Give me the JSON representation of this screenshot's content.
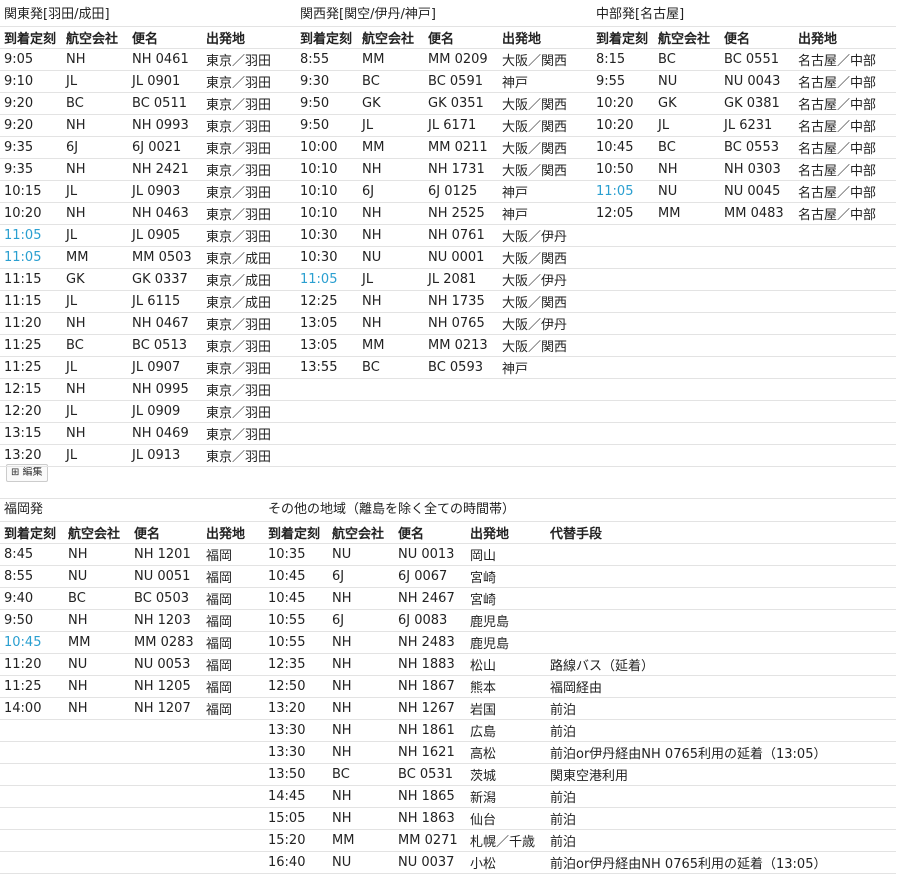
{
  "kanto": {
    "title": "関東発[羽田/成田]",
    "headers": [
      "到着定刻",
      "航空会社",
      "便名",
      "出発地"
    ],
    "rows": [
      [
        "9:05",
        "NH",
        "NH 0461",
        "東京／羽田"
      ],
      [
        "9:10",
        "JL",
        "JL 0901",
        "東京／羽田"
      ],
      [
        "9:20",
        "BC",
        "BC 0511",
        "東京／羽田"
      ],
      [
        "9:20",
        "NH",
        "NH 0993",
        "東京／羽田"
      ],
      [
        "9:35",
        "6J",
        "6J 0021",
        "東京／羽田"
      ],
      [
        "9:35",
        "NH",
        "NH 2421",
        "東京／羽田"
      ],
      [
        "10:15",
        "JL",
        "JL 0903",
        "東京／羽田"
      ],
      [
        "10:20",
        "NH",
        "NH 0463",
        "東京／羽田"
      ],
      [
        "11:05",
        "JL",
        "JL 0905",
        "東京／羽田"
      ],
      [
        "11:05",
        "MM",
        "MM 0503",
        "東京／成田"
      ],
      [
        "11:15",
        "GK",
        "GK 0337",
        "東京／成田"
      ],
      [
        "11:15",
        "JL",
        "JL 6115",
        "東京／成田"
      ],
      [
        "11:20",
        "NH",
        "NH 0467",
        "東京／羽田"
      ],
      [
        "11:25",
        "BC",
        "BC 0513",
        "東京／羽田"
      ],
      [
        "11:25",
        "JL",
        "JL 0907",
        "東京／羽田"
      ],
      [
        "12:15",
        "NH",
        "NH 0995",
        "東京／羽田"
      ],
      [
        "12:20",
        "JL",
        "JL 0909",
        "東京／羽田"
      ],
      [
        "13:15",
        "NH",
        "NH 0469",
        "東京／羽田"
      ],
      [
        "13:20",
        "JL",
        "JL 0913",
        "東京／羽田"
      ]
    ],
    "highlight_rows": [
      8,
      9
    ]
  },
  "kansai": {
    "title": "関西発[関空/伊丹/神戸]",
    "headers": [
      "到着定刻",
      "航空会社",
      "便名",
      "出発地"
    ],
    "rows": [
      [
        "8:55",
        "MM",
        "MM 0209",
        "大阪／関西"
      ],
      [
        "9:30",
        "BC",
        "BC 0591",
        "神戸"
      ],
      [
        "9:50",
        "GK",
        "GK 0351",
        "大阪／関西"
      ],
      [
        "9:50",
        "JL",
        "JL 6171",
        "大阪／関西"
      ],
      [
        "10:00",
        "MM",
        "MM 0211",
        "大阪／関西"
      ],
      [
        "10:10",
        "NH",
        "NH 1731",
        "大阪／関西"
      ],
      [
        "10:10",
        "6J",
        "6J 0125",
        "神戸"
      ],
      [
        "10:10",
        "NH",
        "NH 2525",
        "神戸"
      ],
      [
        "10:30",
        "NH",
        "NH 0761",
        "大阪／伊丹"
      ],
      [
        "10:30",
        "NU",
        "NU 0001",
        "大阪／関西"
      ],
      [
        "11:05",
        "JL",
        "JL 2081",
        "大阪／伊丹"
      ],
      [
        "12:25",
        "NH",
        "NH 1735",
        "大阪／関西"
      ],
      [
        "13:05",
        "NH",
        "NH 0765",
        "大阪／伊丹"
      ],
      [
        "13:05",
        "MM",
        "MM 0213",
        "大阪／関西"
      ],
      [
        "13:55",
        "BC",
        "BC 0593",
        "神戸"
      ]
    ],
    "highlight_rows": [
      10
    ]
  },
  "chubu": {
    "title": "中部発[名古屋]",
    "headers": [
      "到着定刻",
      "航空会社",
      "便名",
      "出発地"
    ],
    "rows": [
      [
        "8:15",
        "BC",
        "BC 0551",
        "名古屋／中部"
      ],
      [
        "9:55",
        "NU",
        "NU 0043",
        "名古屋／中部"
      ],
      [
        "10:20",
        "GK",
        "GK 0381",
        "名古屋／中部"
      ],
      [
        "10:20",
        "JL",
        "JL 6231",
        "名古屋／中部"
      ],
      [
        "10:45",
        "BC",
        "BC 0553",
        "名古屋／中部"
      ],
      [
        "10:50",
        "NH",
        "NH 0303",
        "名古屋／中部"
      ],
      [
        "11:05",
        "NU",
        "NU 0045",
        "名古屋／中部"
      ],
      [
        "12:05",
        "MM",
        "MM 0483",
        "名古屋／中部"
      ]
    ],
    "highlight_rows": [
      6
    ]
  },
  "edit_label": "⊞ 編集",
  "fukuoka": {
    "title": "福岡発",
    "headers": [
      "到着定刻",
      "航空会社",
      "便名",
      "出発地"
    ],
    "rows": [
      [
        "8:45",
        "NH",
        "NH 1201",
        "福岡"
      ],
      [
        "8:55",
        "NU",
        "NU 0051",
        "福岡"
      ],
      [
        "9:40",
        "BC",
        "BC 0503",
        "福岡"
      ],
      [
        "9:50",
        "NH",
        "NH 1203",
        "福岡"
      ],
      [
        "10:45",
        "MM",
        "MM 0283",
        "福岡"
      ],
      [
        "11:20",
        "NU",
        "NU 0053",
        "福岡"
      ],
      [
        "11:25",
        "NH",
        "NH 1205",
        "福岡"
      ],
      [
        "14:00",
        "NH",
        "NH 1207",
        "福岡"
      ]
    ],
    "highlight_rows": [
      4
    ]
  },
  "other": {
    "title": "その他の地域（離島を除く全ての時間帯）",
    "headers": [
      "到着定刻",
      "航空会社",
      "便名",
      "出発地",
      "代替手段"
    ],
    "rows": [
      [
        "10:35",
        "NU",
        "NU 0013",
        "岡山",
        ""
      ],
      [
        "10:45",
        "6J",
        "6J 0067",
        "宮崎",
        ""
      ],
      [
        "10:45",
        "NH",
        "NH 2467",
        "宮崎",
        ""
      ],
      [
        "10:55",
        "6J",
        "6J 0083",
        "鹿児島",
        ""
      ],
      [
        "10:55",
        "NH",
        "NH 2483",
        "鹿児島",
        ""
      ],
      [
        "12:35",
        "NH",
        "NH 1883",
        "松山",
        "路線バス（延着）"
      ],
      [
        "12:50",
        "NH",
        "NH 1867",
        "熊本",
        "福岡経由"
      ],
      [
        "13:20",
        "NH",
        "NH 1267",
        "岩国",
        "前泊"
      ],
      [
        "13:30",
        "NH",
        "NH 1861",
        "広島",
        "前泊"
      ],
      [
        "13:30",
        "NH",
        "NH 1621",
        "高松",
        "前泊or伊丹経由NH 0765利用の延着（13:05）"
      ],
      [
        "13:50",
        "BC",
        "BC 0531",
        "茨城",
        "関東空港利用"
      ],
      [
        "14:45",
        "NH",
        "NH 1865",
        "新潟",
        "前泊"
      ],
      [
        "15:05",
        "NH",
        "NH 1863",
        "仙台",
        "前泊"
      ],
      [
        "15:20",
        "MM",
        "MM 0271",
        "札幌／千歳",
        "前泊"
      ],
      [
        "16:40",
        "NU",
        "NU 0037",
        "小松",
        "前泊or伊丹経由NH 0765利用の延着（13:05）"
      ]
    ],
    "highlight_rows": []
  }
}
